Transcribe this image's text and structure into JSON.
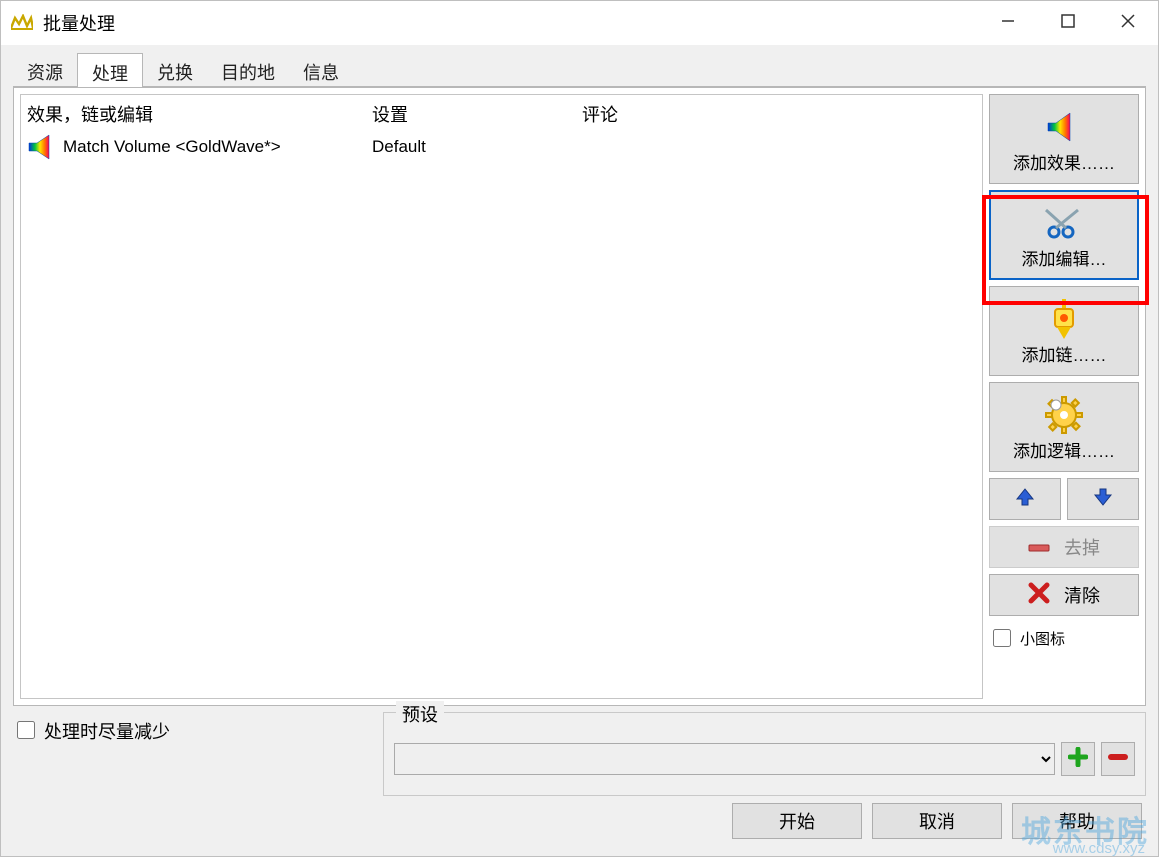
{
  "window": {
    "title": "批量处理"
  },
  "titlebar_controls": {
    "minimize": "window-minimize",
    "maximize": "window-maximize",
    "close": "window-close"
  },
  "tabs": [
    "资源",
    "处理",
    "兑换",
    "目的地",
    "信息"
  ],
  "active_tab_index": 1,
  "columns": {
    "a": "效果，链或编辑",
    "b": "设置",
    "c": "评论"
  },
  "rows": [
    {
      "name": "Match Volume <GoldWave*>",
      "setting": "Default",
      "comment": ""
    }
  ],
  "sidebar": {
    "add_effect": "添加效果……",
    "add_edit": "添加编辑…",
    "add_chain": "添加链……",
    "add_logic": "添加逻辑……",
    "remove": "去掉",
    "clear": "清除",
    "small_icons": "小图标"
  },
  "bottom": {
    "reduce": "处理时尽量减少",
    "preset_legend": "预设",
    "preset_value": ""
  },
  "footer": {
    "start": "开始",
    "cancel": "取消",
    "help": "帮助"
  },
  "watermark": {
    "big": "城东书院",
    "small": "www.cdsy.xyz"
  }
}
